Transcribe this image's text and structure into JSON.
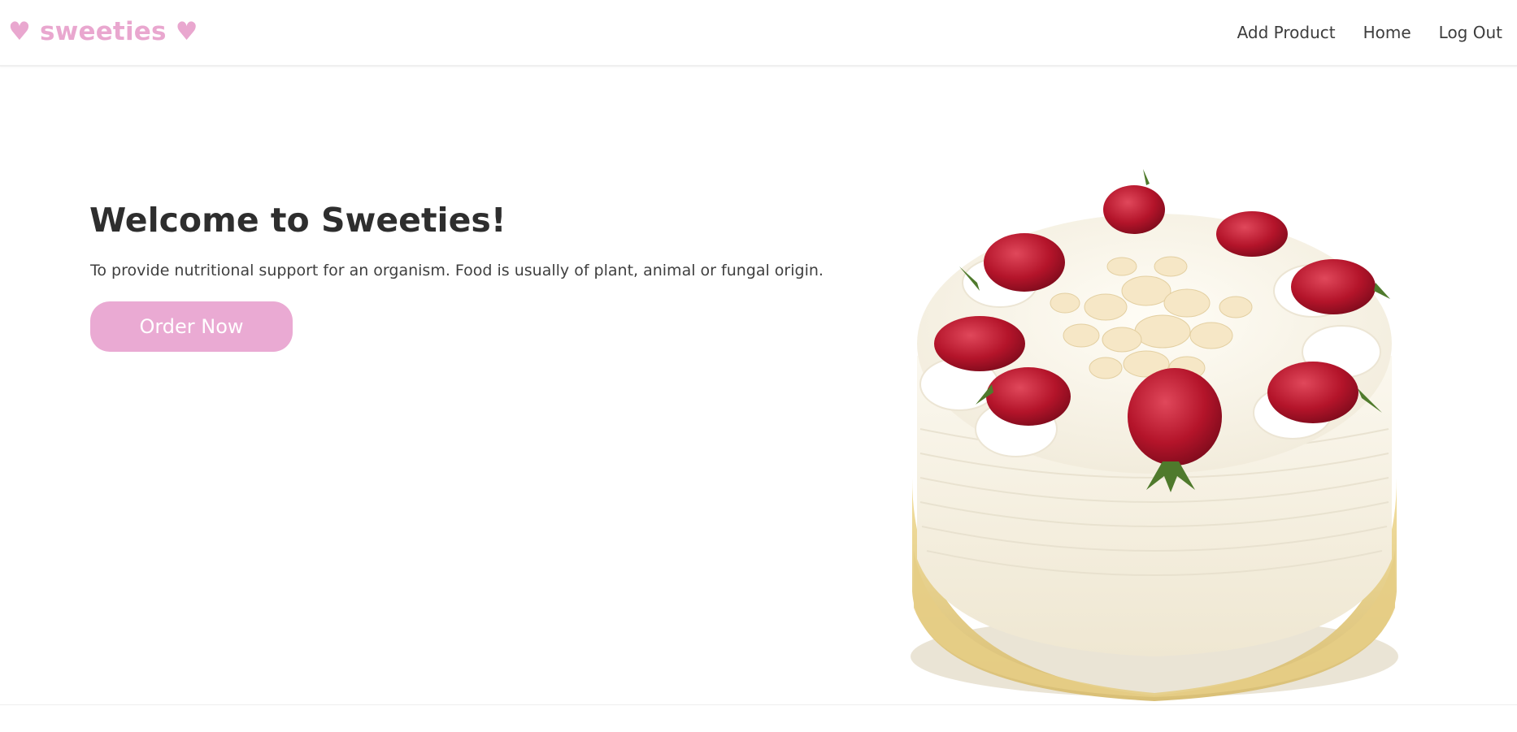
{
  "brand": {
    "name": "♥ sweeties ♥",
    "color": "#e9a7cf"
  },
  "nav": {
    "items": [
      {
        "label": "Add Product"
      },
      {
        "label": "Home"
      },
      {
        "label": "Log Out"
      }
    ]
  },
  "hero": {
    "title": "Welcome to Sweeties!",
    "description": "To provide nutritional support for an organism. Food is usually of plant, animal or fungal origin.",
    "cta_label": "Order Now",
    "cta_color": "#eaaad3"
  },
  "image": {
    "subject": "strawberry-cream-cake"
  }
}
